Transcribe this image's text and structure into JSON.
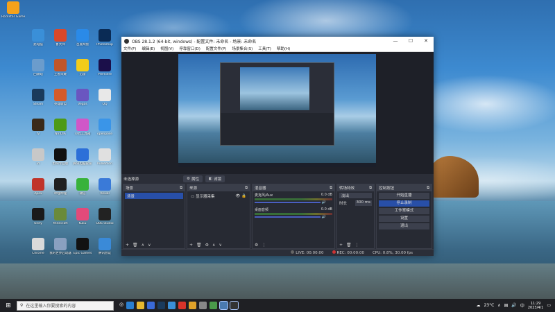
{
  "desktop": {
    "icons": [
      {
        "label": "Rockstar Games",
        "color": "#f5a21a"
      },
      {
        "label": "此电脑",
        "color": "#3a8fd8"
      },
      {
        "label": "鲁大师",
        "color": "#d9482a"
      },
      {
        "label": "百度网盘",
        "color": "#2a8ae8"
      },
      {
        "label": "Photoshop",
        "color": "#0a2b55"
      },
      {
        "label": "回收站",
        "color": "#6b9ccc"
      },
      {
        "label": "王者荣耀",
        "color": "#c0562a"
      },
      {
        "label": "迅雷",
        "color": "#f2cc1a"
      },
      {
        "label": "Premiere",
        "color": "#1b0f4a"
      },
      {
        "label": "Steam",
        "color": "#1a3a5c"
      },
      {
        "label": "英雄联盟",
        "color": "#d45b2b"
      },
      {
        "label": "Vegas",
        "color": "#6a56c0"
      },
      {
        "label": "QQ",
        "color": "#e8e8e8"
      },
      {
        "label": "IV",
        "color": "#3a2a1a"
      },
      {
        "label": "NVIDIA",
        "color": "#4d9a16"
      },
      {
        "label": "小丸工具箱",
        "color": "#d057c8"
      },
      {
        "label": "openpose",
        "color": "#3a95e8"
      },
      {
        "label": "VI",
        "color": "#c8c8c8"
      },
      {
        "label": "剪映专业版",
        "color": "#111111"
      },
      {
        "label": "腾讯电脑管家",
        "color": "#2c6fd8"
      },
      {
        "label": "Pulsemon",
        "color": "#e0e0e0"
      },
      {
        "label": "Apex",
        "color": "#c0342a"
      },
      {
        "label": "哔哩哔哩",
        "color": "#202020"
      },
      {
        "label": "微信",
        "color": "#38b23a"
      },
      {
        "label": "Visual",
        "color": "#3a7ad8"
      },
      {
        "label": "Unity",
        "color": "#1a1a1a"
      },
      {
        "label": "Minecraft",
        "color": "#6a8a3a"
      },
      {
        "label": "Kuku",
        "color": "#e24a7a"
      },
      {
        "label": "OBS Studio",
        "color": "#222222"
      },
      {
        "label": "Chrome",
        "color": "#dadada"
      },
      {
        "label": "我的世界启动器",
        "color": "#8aa0c0"
      },
      {
        "label": "Epic Games",
        "color": "#121212"
      },
      {
        "label": "腾讯会议",
        "color": "#3a8ad8"
      }
    ]
  },
  "obs": {
    "title": "OBS 28.1.2 (64-bit, windows) - 配置文件: 未命名 - 场景: 未命名",
    "menu": [
      "文件(F)",
      "编辑(E)",
      "视图(V)",
      "停靠窗口(D)",
      "配置文件(P)",
      "场景集合(S)",
      "工具(T)",
      "帮助(H)"
    ],
    "program_bar": {
      "label": "未选择源",
      "props_btn": "属性",
      "filters_btn": "滤镜"
    },
    "docks": {
      "scenes": {
        "title": "场景",
        "items": [
          "场景"
        ]
      },
      "sources": {
        "title": "来源",
        "items": [
          "显示器采集"
        ]
      },
      "mixer": {
        "title": "混音器",
        "channels": [
          {
            "name": "麦克风/Aux",
            "db": "0.0 dB"
          },
          {
            "name": "桌面音频",
            "db": "0.0 dB"
          }
        ]
      },
      "transitions": {
        "title": "转场特效",
        "type": "淡出",
        "duration_label": "时长",
        "duration": "300 ms"
      },
      "controls": {
        "title": "控制按钮",
        "buttons": [
          "开始直播",
          "停止录制",
          "工作室模式",
          "设置",
          "退出"
        ],
        "active_index": 1
      }
    },
    "status": {
      "live": "LIVE: 00:00:00",
      "rec": "REC: 00:00:00",
      "cpu": "CPU: 0.8%, 30.00 fps"
    }
  },
  "taskbar": {
    "search_placeholder": "在这里输入你要搜索的内容",
    "weather": "23°C",
    "time": "11:29",
    "date": "2023/4/1",
    "ime": "中"
  }
}
